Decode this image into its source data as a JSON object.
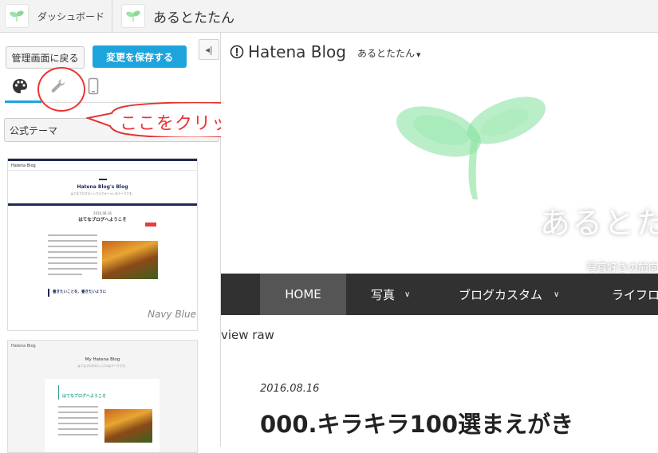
{
  "topbar": {
    "dashboard_label": "ダッシュボード",
    "blog_title": "あるとたたん"
  },
  "sidebar": {
    "back_button": "管理画面に戻る",
    "save_button": "変更を保存する",
    "collapse_glyph": "◂|",
    "tabs": [
      {
        "name": "design",
        "icon": "palette-icon",
        "active": true
      },
      {
        "name": "customize",
        "icon": "wrench-icon",
        "active": false
      },
      {
        "name": "smartphone",
        "icon": "smartphone-icon",
        "active": false
      }
    ],
    "theme_select": "公式テーマ",
    "themes": [
      {
        "label": "Navy Blue",
        "mini_brand": "Hatena Blog",
        "mini_title": "Hatena Blog's Blog",
        "mini_subtitle": "はてなブログのシンプルでオシャレなテーマです。",
        "mini_date": "2016.08.16",
        "mini_post_title": "はてなブログへようこそ",
        "mini_section": "書きたいことを、書きたいように"
      },
      {
        "label": "",
        "mini_brand": "Hatena Blog",
        "mini_title": "My Hatena Blog",
        "mini_subtitle": "はてなブログのシンプルなテーマです。",
        "mini_post_title": "はてなブログへようこそ"
      }
    ]
  },
  "annotation": {
    "text": "ここをクリック",
    "color": "#e33333"
  },
  "preview": {
    "brand": "Hatena Blog",
    "blog_menu": "あるとたたん",
    "hero_title": "あるとた",
    "hero_subtitle": "写真好きの前向",
    "nav": [
      {
        "label": "HOME",
        "active": true
      },
      {
        "label": "写真",
        "dropdown": true
      },
      {
        "label": "ブログカスタム",
        "dropdown": true
      },
      {
        "label": "ライフロ"
      }
    ],
    "view_raw": "view raw",
    "post_date": "2016.08.16",
    "post_title": "000.キラキラ100選まえがき"
  },
  "colors": {
    "accent": "#1ea4dc",
    "nav_bg": "#313131",
    "annotation": "#e33333"
  }
}
